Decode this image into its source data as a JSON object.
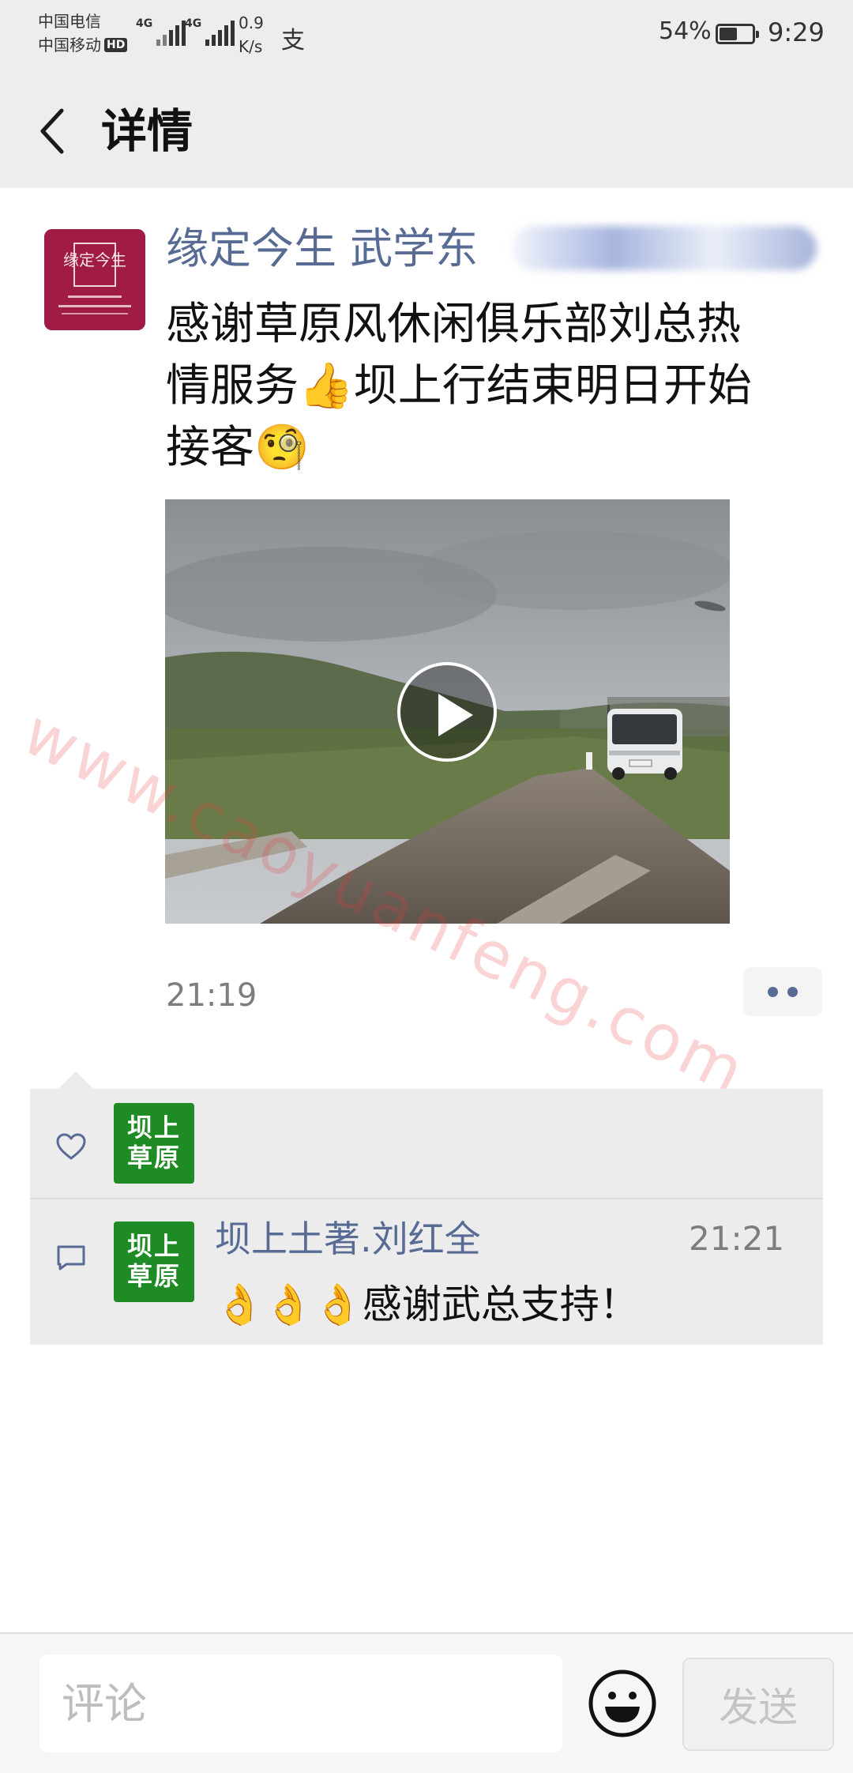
{
  "status_bar": {
    "carrier_1": "中国电信",
    "carrier_2": "中国移动",
    "hd_badge": "HD",
    "signal_1_label": "4G",
    "signal_2_label": "4G",
    "net_speed_value": "0.9",
    "net_speed_unit": "K/s",
    "alipay_icon": "支",
    "battery_percent": "54%",
    "battery_level": 0.54,
    "time": "9:29"
  },
  "nav": {
    "back_icon": "chevron-left-icon",
    "title": "详情"
  },
  "post": {
    "author": "缘定今生 武学东",
    "avatar_logo": "缘定今生",
    "text_line_1": "感谢草原风休闲俱乐部刘总热",
    "text_line_2": "情服务👍坝上行结束明日开始",
    "text_line_3": "接客🧐",
    "watermark": "www.caoyuanfeng.com",
    "time": "21:19",
    "more_icon": "more-dots-icon"
  },
  "interactions": {
    "like_icon": "heart-outline-icon",
    "like_avatar_label": "坝上草原",
    "like_avatar_line_1": "坝上",
    "like_avatar_line_2": "草原",
    "comment_icon": "comment-bubble-icon",
    "comments": [
      {
        "author": "坝上土著.刘红全",
        "time": "21:21",
        "text": "👌👌👌感谢武总支持！",
        "avatar_line_1": "坝上",
        "avatar_line_2": "草原"
      }
    ]
  },
  "bottom_bar": {
    "input_placeholder": "评论",
    "emoji_icon": "smiley-face-icon",
    "send_label": "发送"
  },
  "colors": {
    "link_blue": "#576b95",
    "background_gray": "#ededed",
    "avatar_green": "#1e8b24",
    "avatar_crimson": "#a11c44"
  }
}
